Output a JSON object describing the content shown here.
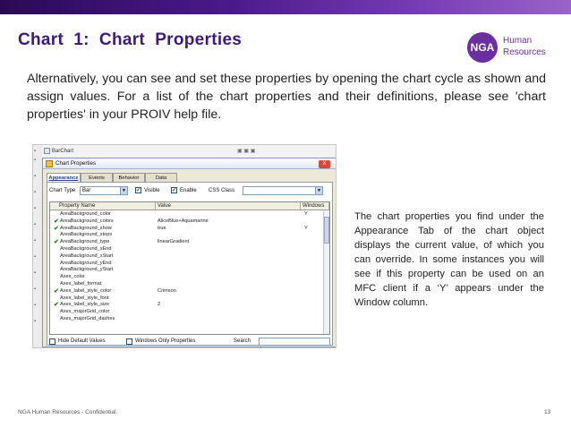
{
  "slide": {
    "title": "Chart  1:  Chart  Properties",
    "logo_mark": "NGA",
    "logo_line1": "Human",
    "logo_line2": "Resources",
    "intro": "Alternatively, you can see and set these properties by opening the chart cycle as shown and assign values. For a list of the chart properties and their definitions, please see 'chart properties' in your PROIV help file.",
    "side_note": "The chart properties you find under the Appearance Tab of the chart object displays the current value, of which you can override. In some instances you will see if this property can be used on an MFC client if a ‘Y’ appears under the Window column.",
    "footer_left": "NGA Human Resources - Confidential.",
    "page_number": "13",
    "colors": {
      "title": "#3b1a78",
      "brand": "#6a2fa0",
      "check": "#1a8a1a"
    }
  },
  "tree": {
    "node_label": "BarChart",
    "icon": "chart-node-icon"
  },
  "dialog": {
    "title": "Chart Properties",
    "close_label": "X",
    "tabs": [
      {
        "label": "Appearance",
        "active": true
      },
      {
        "label": "Events",
        "active": false
      },
      {
        "label": "Behavior",
        "active": false
      },
      {
        "label": "Data",
        "active": false
      }
    ],
    "controls": {
      "chart_type_label": "Chart Type",
      "chart_type_value": "Bar",
      "visible_label": "Visible",
      "visible_checked": true,
      "enable_label": "Enable",
      "enable_checked": true,
      "css_class_label": "CSS Class",
      "css_class_value": ""
    },
    "grid": {
      "headers": [
        "Property Name",
        "Value",
        "Windows"
      ],
      "rows": [
        {
          "check": false,
          "name": "AreaBackground_color",
          "value": "",
          "windows": "Y"
        },
        {
          "check": true,
          "name": "AreaBackground_colors",
          "value": "AliceBlue+Aquamarine",
          "windows": ""
        },
        {
          "check": true,
          "name": "AreaBackground_show",
          "value": "true",
          "windows": "Y"
        },
        {
          "check": false,
          "name": "AreaBackground_stops",
          "value": "",
          "windows": ""
        },
        {
          "check": true,
          "name": "AreaBackground_type",
          "value": "linearGradient",
          "windows": ""
        },
        {
          "check": false,
          "name": "AreaBackground_xEnd",
          "value": "",
          "windows": ""
        },
        {
          "check": false,
          "name": "AreaBackground_xStart",
          "value": "",
          "windows": ""
        },
        {
          "check": false,
          "name": "AreaBackground_yEnd",
          "value": "",
          "windows": ""
        },
        {
          "check": false,
          "name": "AreaBackground_yStart",
          "value": "",
          "windows": ""
        },
        {
          "check": false,
          "name": "Axes_color",
          "value": "",
          "windows": ""
        },
        {
          "check": false,
          "name": "Axes_label_format",
          "value": "",
          "windows": ""
        },
        {
          "check": true,
          "name": "Axes_label_style_color",
          "value": "Crimson",
          "windows": ""
        },
        {
          "check": false,
          "name": "Axes_label_style_font",
          "value": "",
          "windows": ""
        },
        {
          "check": true,
          "name": "Axes_label_style_size",
          "value": "2",
          "windows": ""
        },
        {
          "check": false,
          "name": "Axes_majorGrid_color",
          "value": "",
          "windows": ""
        },
        {
          "check": false,
          "name": "Axes_majorGrid_dashes",
          "value": "",
          "windows": ""
        }
      ]
    },
    "bottom": {
      "hide_defaults_label": "Hide Default Values",
      "windows_only_label": "Windows Only Properties",
      "search_label": "Search",
      "search_value": ""
    }
  }
}
